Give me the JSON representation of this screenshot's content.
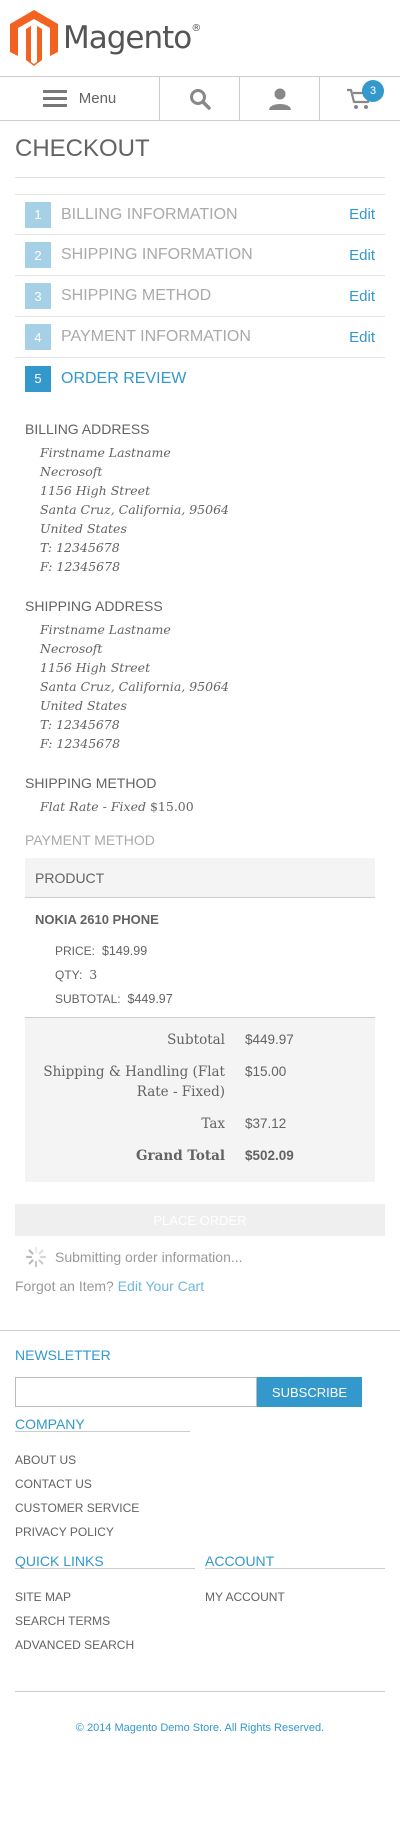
{
  "brand": {
    "name": "Magento",
    "mark": "®",
    "logo_color": "#f26322"
  },
  "nav": {
    "menu_label": "Menu",
    "cart_count": "3"
  },
  "page_title": "CHECKOUT",
  "steps": [
    {
      "num": "1",
      "title": "BILLING INFORMATION",
      "edit": "Edit"
    },
    {
      "num": "2",
      "title": "SHIPPING INFORMATION",
      "edit": "Edit"
    },
    {
      "num": "3",
      "title": "SHIPPING METHOD",
      "edit": "Edit"
    },
    {
      "num": "4",
      "title": "PAYMENT INFORMATION",
      "edit": "Edit"
    },
    {
      "num": "5",
      "title": "ORDER REVIEW",
      "edit": ""
    }
  ],
  "billing": {
    "heading": "BILLING ADDRESS",
    "lines": [
      "Firstname Lastname",
      "Necrosoft",
      "1156 High Street",
      "Santa Cruz, California, 95064",
      "United States",
      "T: 12345678",
      "F: 12345678"
    ]
  },
  "shipping": {
    "heading": "SHIPPING ADDRESS",
    "lines": [
      "Firstname Lastname",
      "Necrosoft",
      "1156 High Street",
      "Santa Cruz, California, 95064",
      "United States",
      "T: 12345678",
      "F: 12345678"
    ]
  },
  "shipping_method": {
    "heading": "SHIPPING METHOD",
    "name": "Flat Rate - Fixed",
    "price": "$15.00"
  },
  "payment_method": {
    "heading": "PAYMENT METHOD"
  },
  "product": {
    "column_header": "PRODUCT",
    "name": "NOKIA 2610 PHONE",
    "price_label": "PRICE:",
    "price": "$149.99",
    "qty_label": "QTY:",
    "qty": "3",
    "subtotal_label": "SUBTOTAL:",
    "subtotal": "$449.97"
  },
  "totals": {
    "subtotal_label": "Subtotal",
    "subtotal": "$449.97",
    "shipping_label": "Shipping & Handling (Flat Rate - Fixed)",
    "shipping": "$15.00",
    "tax_label": "Tax",
    "tax": "$37.12",
    "grand_label": "Grand Total",
    "grand": "$502.09"
  },
  "place_order_label": "PLACE ORDER",
  "submitting_text": "Submitting order information...",
  "forgot": {
    "text": "Forgot an Item?",
    "link": "Edit Your Cart"
  },
  "footer": {
    "newsletter_heading": "NEWSLETTER",
    "subscribe_label": "SUBSCRIBE",
    "company_heading": "COMPANY",
    "company_links": [
      "ABOUT US",
      "CONTACT US",
      "CUSTOMER SERVICE",
      "PRIVACY POLICY"
    ],
    "quick_heading": "QUICK LINKS",
    "quick_links": [
      "SITE MAP",
      "SEARCH TERMS",
      "ADVANCED SEARCH"
    ],
    "account_heading": "ACCOUNT",
    "account_links": [
      "MY ACCOUNT"
    ],
    "copyright": "© 2014 Magento Demo Store. All Rights Reserved."
  },
  "colors": {
    "accent": "#3399cc",
    "step_inactive": "#a6d0e6",
    "panel": "#f4f4f4"
  }
}
